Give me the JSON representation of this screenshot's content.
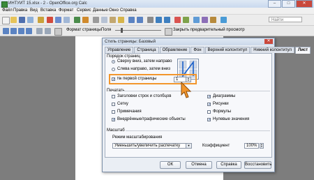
{
  "window": {
    "title": "ИНТУИТ 15.xlsx - 2 - OpenOffice.org Calc",
    "minimize": "–",
    "maximize": "□",
    "close": "✕"
  },
  "menu": [
    "Файл",
    "Правка",
    "Вид",
    "Вставка",
    "Формат",
    "Сервис",
    "Данные",
    "Окно",
    "Справка"
  ],
  "toolbar2": {
    "page_format": "Формат страницы",
    "margins": "Поля",
    "close_preview": "Закрыть предварительный просмотр"
  },
  "search": {
    "placeholder": "Найти"
  },
  "dialog": {
    "title": "Стиль страницы: Базовый",
    "close": "✕",
    "tabs": [
      "Управление",
      "Страница",
      "Обрамление",
      "Фон",
      "Верхний колонтитул",
      "Нижний колонтитул",
      "Лист"
    ],
    "active_tab": 6,
    "page_order": {
      "heading": "Порядок страниц",
      "option_top_down": "Сверху вниз, затем направо",
      "option_left_right": "Слева направо, затем вниз",
      "selected": "top_down"
    },
    "first_page_number": {
      "label": "№ первой страницы",
      "checked": true,
      "value": "1"
    },
    "print": {
      "heading": "Печатать",
      "left": [
        {
          "label": "Заголовки строк и столбцов",
          "checked": false
        },
        {
          "label": "Сетку",
          "checked": false
        },
        {
          "label": "Примечания",
          "checked": false
        },
        {
          "label": "Внедрённые/графические объекты",
          "checked": true
        }
      ],
      "right": [
        {
          "label": "Диаграммы",
          "checked": true
        },
        {
          "label": "Рисунки",
          "checked": true
        },
        {
          "label": "Формулы",
          "checked": false
        },
        {
          "label": "Нулевые значения",
          "checked": true
        }
      ]
    },
    "scale": {
      "heading": "Масштаб",
      "mode_label": "Режим масштабирования",
      "mode_value": "Уменьшить/увеличить распечатку",
      "coef_label": "Коэффициент",
      "coef_value": "100%"
    },
    "buttons": {
      "ok": "ОК",
      "cancel": "Отмена",
      "help": "Справка",
      "reset": "Восстановить"
    }
  },
  "colors": {
    "accent_highlight": "#f2962c",
    "dialog_bg": "#eaeef4"
  }
}
